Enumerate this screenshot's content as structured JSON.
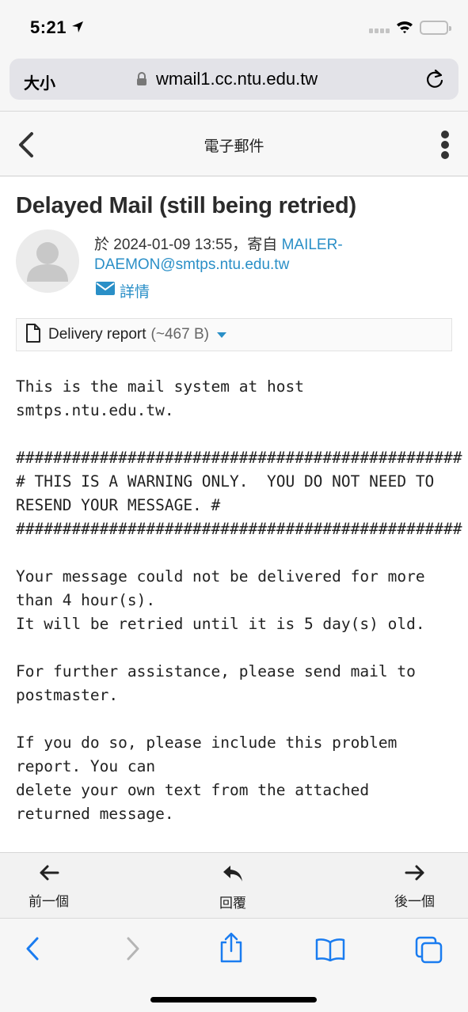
{
  "status_bar": {
    "time": "5:21"
  },
  "browser": {
    "text_size_label": "大小",
    "url": "wmail1.cc.ntu.edu.tw"
  },
  "header": {
    "title": "電子郵件"
  },
  "message": {
    "subject": "Delayed Mail (still being retried)",
    "date_prefix": "於 2024-01-09 13:55，寄自 ",
    "sender_part1": "MAILER-",
    "sender_part2": "DAEMON@smtps.ntu.edu.tw",
    "details_label": "詳情",
    "attachment": {
      "name": "Delivery report",
      "size": "(~467 B)"
    },
    "body": "This is the mail system at host\nsmtps.ntu.edu.tw.\n\n################################################\n# THIS IS A WARNING ONLY.  YOU DO NOT NEED TO\nRESEND YOUR MESSAGE. #\n################################################\n\nYour message could not be delivered for more\nthan 4 hour(s).\nIt will be retried until it is 5 day(s) old.\n\nFor further assistance, please send mail to\npostmaster.\n\nIf you do so, please include this problem\nreport. You can\ndelete your own text from the attached\nreturned message."
  },
  "actions": {
    "prev": "前一個",
    "reply": "回覆",
    "next": "後一個"
  },
  "colors": {
    "link": "#2a8fc7",
    "safari_blue": "#1a7cf0"
  },
  "icons": [
    "location-arrow-icon",
    "wifi-icon",
    "battery-icon",
    "lock-icon",
    "reload-icon",
    "chevron-left-icon",
    "more-vertical-icon",
    "envelope-icon",
    "document-icon",
    "arrow-left-icon",
    "reply-icon",
    "arrow-right-icon",
    "share-icon",
    "bookmarks-icon",
    "tabs-icon"
  ]
}
